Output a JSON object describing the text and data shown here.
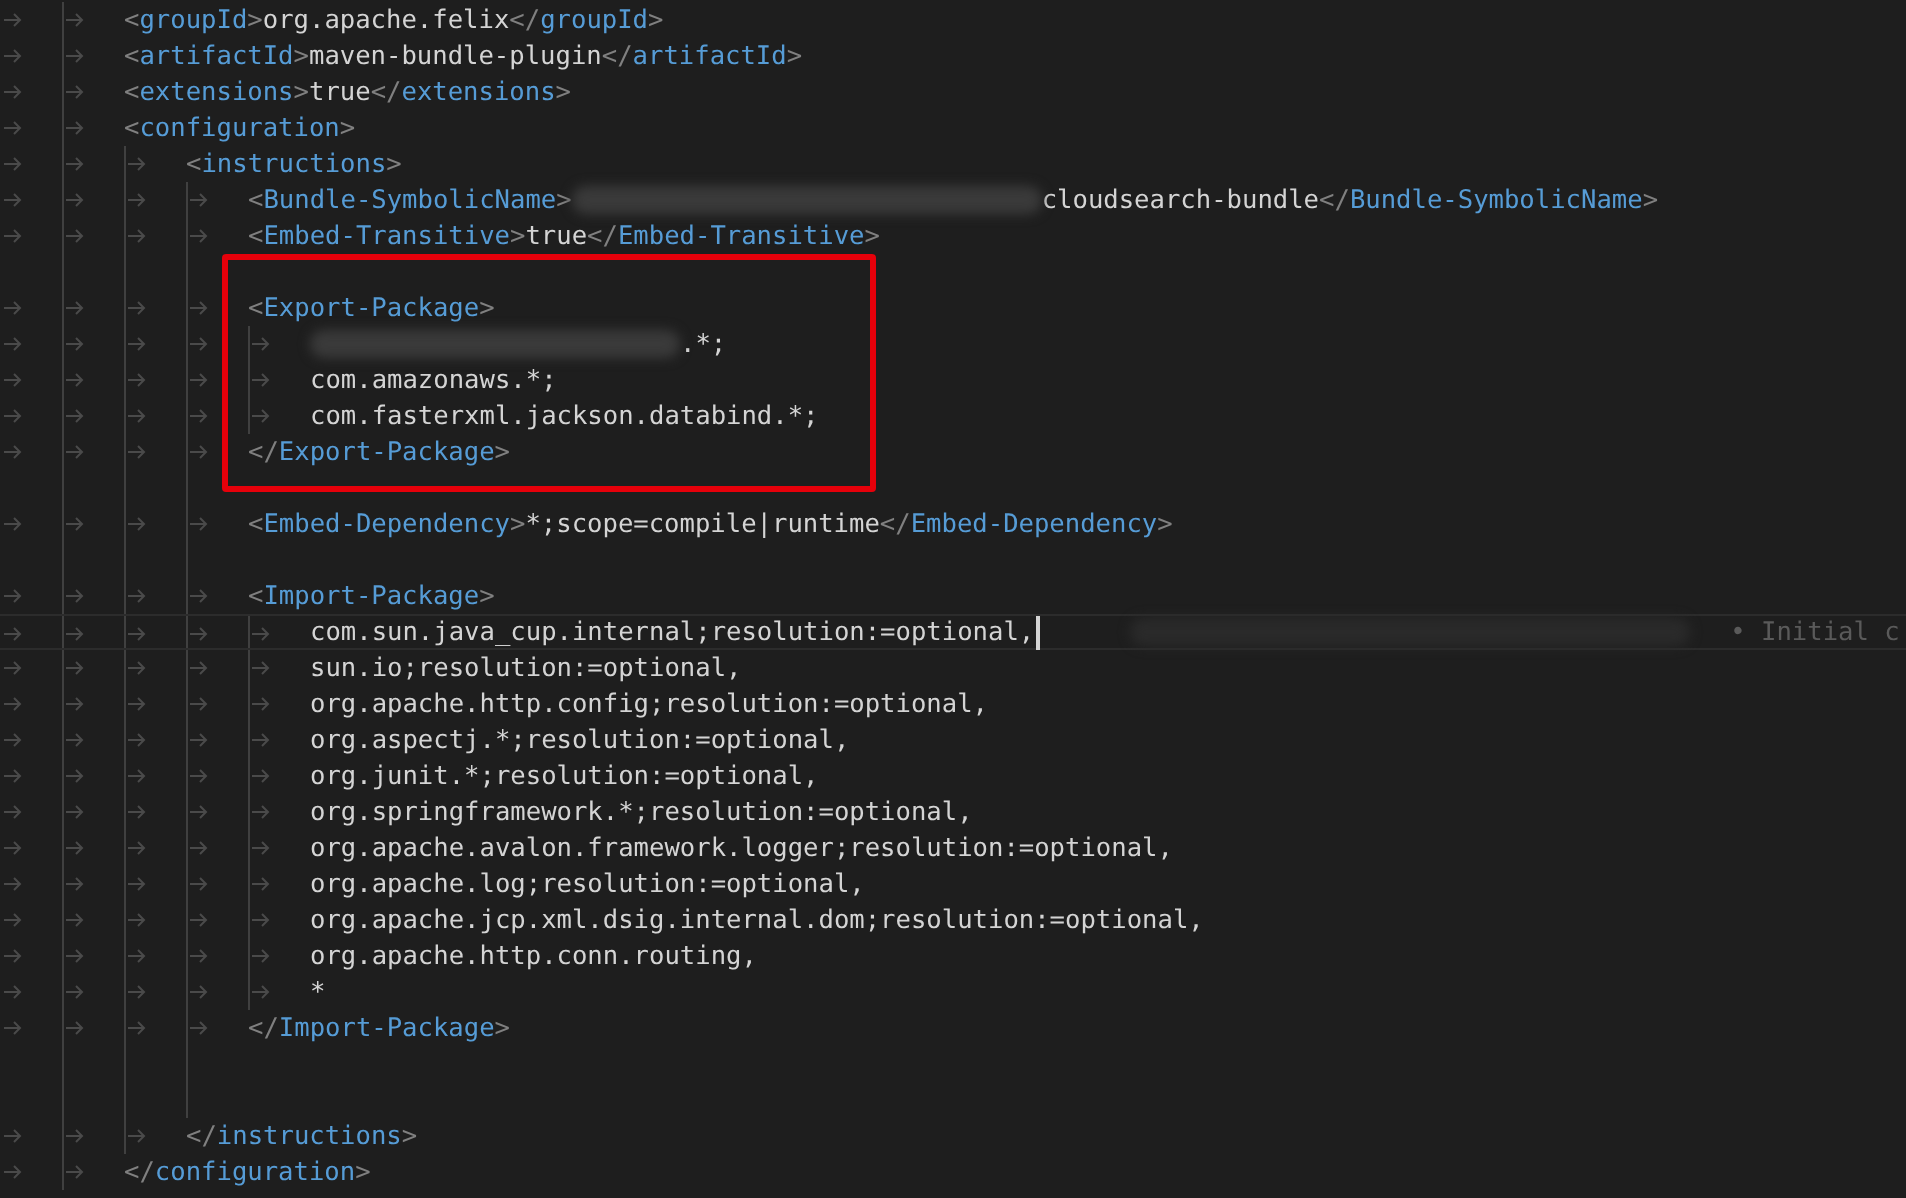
{
  "editor": {
    "lines": [
      {
        "kind": "scope",
        "children": [
          {
            "kind": "scope",
            "children": [
              {
                "kind": "line",
                "tokens": [
                  {
                    "kind": "punct",
                    "text": "<"
                  },
                  {
                    "kind": "tag",
                    "text": "groupId"
                  },
                  {
                    "kind": "punct",
                    "text": ">"
                  },
                  {
                    "kind": "text",
                    "text": "org.apache.felix"
                  },
                  {
                    "kind": "punct",
                    "text": "</"
                  },
                  {
                    "kind": "tag",
                    "text": "groupId"
                  },
                  {
                    "kind": "punct",
                    "text": ">"
                  }
                ]
              },
              {
                "kind": "line",
                "tokens": [
                  {
                    "kind": "punct",
                    "text": "<"
                  },
                  {
                    "kind": "tag",
                    "text": "artifactId"
                  },
                  {
                    "kind": "punct",
                    "text": ">"
                  },
                  {
                    "kind": "text",
                    "text": "maven-bundle-plugin"
                  },
                  {
                    "kind": "punct",
                    "text": "</"
                  },
                  {
                    "kind": "tag",
                    "text": "artifactId"
                  },
                  {
                    "kind": "punct",
                    "text": ">"
                  }
                ]
              },
              {
                "kind": "line",
                "tokens": [
                  {
                    "kind": "punct",
                    "text": "<"
                  },
                  {
                    "kind": "tag",
                    "text": "extensions"
                  },
                  {
                    "kind": "punct",
                    "text": ">"
                  },
                  {
                    "kind": "text",
                    "text": "true"
                  },
                  {
                    "kind": "punct",
                    "text": "</"
                  },
                  {
                    "kind": "tag",
                    "text": "extensions"
                  },
                  {
                    "kind": "punct",
                    "text": ">"
                  }
                ]
              },
              {
                "kind": "line",
                "tokens": [
                  {
                    "kind": "punct",
                    "text": "<"
                  },
                  {
                    "kind": "tag",
                    "text": "configuration"
                  },
                  {
                    "kind": "punct",
                    "text": ">"
                  }
                ],
                "children": [
                  {
                    "kind": "line",
                    "tokens": [
                      {
                        "kind": "punct",
                        "text": "<"
                      },
                      {
                        "kind": "tag",
                        "text": "instructions"
                      },
                      {
                        "kind": "punct",
                        "text": ">"
                      }
                    ],
                    "children": [
                      {
                        "kind": "line",
                        "tokens": [
                          {
                            "kind": "punct",
                            "text": "<"
                          },
                          {
                            "kind": "tag",
                            "text": "Bundle-SymbolicName"
                          },
                          {
                            "kind": "punct",
                            "text": ">"
                          },
                          {
                            "kind": "redacted"
                          },
                          {
                            "kind": "text",
                            "text": "cloudsearch-bundle"
                          },
                          {
                            "kind": "punct",
                            "text": "</"
                          },
                          {
                            "kind": "tag",
                            "text": "Bundle-SymbolicName"
                          },
                          {
                            "kind": "punct",
                            "text": ">"
                          }
                        ]
                      },
                      {
                        "kind": "line",
                        "tokens": [
                          {
                            "kind": "punct",
                            "text": "<"
                          },
                          {
                            "kind": "tag",
                            "text": "Embed-Transitive"
                          },
                          {
                            "kind": "punct",
                            "text": ">"
                          },
                          {
                            "kind": "text",
                            "text": "true"
                          },
                          {
                            "kind": "punct",
                            "text": "</"
                          },
                          {
                            "kind": "tag",
                            "text": "Embed-Transitive"
                          },
                          {
                            "kind": "punct",
                            "text": ">"
                          }
                        ]
                      },
                      {
                        "kind": "group",
                        "highlighted": true,
                        "children": [
                          {
                            "kind": "blank"
                          },
                          {
                            "kind": "line",
                            "tokens": [
                              {
                                "kind": "punct",
                                "text": "<"
                              },
                              {
                                "kind": "tag",
                                "text": "Export-Package"
                              },
                              {
                                "kind": "punct",
                                "text": ">"
                              }
                            ],
                            "children": [
                              {
                                "kind": "line",
                                "tokens": [
                                  {
                                    "kind": "redacted"
                                  },
                                  {
                                    "kind": "text",
                                    "text": ".*;"
                                  }
                                ]
                              },
                              {
                                "kind": "line",
                                "tokens": [
                                  {
                                    "kind": "text",
                                    "text": "com.amazonaws.*;"
                                  }
                                ]
                              },
                              {
                                "kind": "line",
                                "tokens": [
                                  {
                                    "kind": "text",
                                    "text": "com.fasterxml.jackson.databind.*;"
                                  }
                                ]
                              }
                            ]
                          },
                          {
                            "kind": "line",
                            "tokens": [
                              {
                                "kind": "punct",
                                "text": "</"
                              },
                              {
                                "kind": "tag",
                                "text": "Export-Package"
                              },
                              {
                                "kind": "punct",
                                "text": ">"
                              }
                            ]
                          }
                        ]
                      },
                      {
                        "kind": "blank"
                      },
                      {
                        "kind": "line",
                        "tokens": [
                          {
                            "kind": "punct",
                            "text": "<"
                          },
                          {
                            "kind": "tag",
                            "text": "Embed-Dependency"
                          },
                          {
                            "kind": "punct",
                            "text": ">"
                          },
                          {
                            "kind": "text",
                            "text": "*;scope=compile|runtime"
                          },
                          {
                            "kind": "punct",
                            "text": "</"
                          },
                          {
                            "kind": "tag",
                            "text": "Embed-Dependency"
                          },
                          {
                            "kind": "punct",
                            "text": ">"
                          }
                        ]
                      },
                      {
                        "kind": "blank"
                      },
                      {
                        "kind": "line",
                        "tokens": [
                          {
                            "kind": "punct",
                            "text": "<"
                          },
                          {
                            "kind": "tag",
                            "text": "Import-Package"
                          },
                          {
                            "kind": "punct",
                            "text": ">"
                          }
                        ],
                        "children": [
                          {
                            "kind": "line",
                            "cursor": true,
                            "blame": "• Initial c",
                            "tokens": [
                              {
                                "kind": "text",
                                "text": "com.sun.java_cup.internal;resolution:=optional,"
                              }
                            ]
                          },
                          {
                            "kind": "line",
                            "tokens": [
                              {
                                "kind": "text",
                                "text": "sun.io;resolution:=optional,"
                              }
                            ]
                          },
                          {
                            "kind": "line",
                            "tokens": [
                              {
                                "kind": "text",
                                "text": "org.apache.http.config;resolution:=optional,"
                              }
                            ]
                          },
                          {
                            "kind": "line",
                            "tokens": [
                              {
                                "kind": "text",
                                "text": "org.aspectj.*;resolution:=optional,"
                              }
                            ]
                          },
                          {
                            "kind": "line",
                            "tokens": [
                              {
                                "kind": "text",
                                "text": "org.junit.*;resolution:=optional,"
                              }
                            ]
                          },
                          {
                            "kind": "line",
                            "tokens": [
                              {
                                "kind": "text",
                                "text": "org.springframework.*;resolution:=optional,"
                              }
                            ]
                          },
                          {
                            "kind": "line",
                            "tokens": [
                              {
                                "kind": "text",
                                "text": "org.apache.avalon.framework.logger;resolution:=optional,"
                              }
                            ]
                          },
                          {
                            "kind": "line",
                            "tokens": [
                              {
                                "kind": "text",
                                "text": "org.apache.log;resolution:=optional,"
                              }
                            ]
                          },
                          {
                            "kind": "line",
                            "tokens": [
                              {
                                "kind": "text",
                                "text": "org.apache.jcp.xml.dsig.internal.dom;resolution:=optional,"
                              }
                            ]
                          },
                          {
                            "kind": "line",
                            "tokens": [
                              {
                                "kind": "text",
                                "text": "org.apache.http.conn.routing,"
                              }
                            ]
                          },
                          {
                            "kind": "line",
                            "tokens": [
                              {
                                "kind": "text",
                                "text": "*"
                              }
                            ]
                          }
                        ]
                      },
                      {
                        "kind": "line",
                        "tokens": [
                          {
                            "kind": "punct",
                            "text": "</"
                          },
                          {
                            "kind": "tag",
                            "text": "Import-Package"
                          },
                          {
                            "kind": "punct",
                            "text": ">"
                          }
                        ]
                      },
                      {
                        "kind": "blank"
                      },
                      {
                        "kind": "blank"
                      }
                    ]
                  },
                  {
                    "kind": "line",
                    "tokens": [
                      {
                        "kind": "punct",
                        "text": "</"
                      },
                      {
                        "kind": "tag",
                        "text": "instructions"
                      },
                      {
                        "kind": "punct",
                        "text": ">"
                      }
                    ]
                  }
                ]
              },
              {
                "kind": "line",
                "tokens": [
                  {
                    "kind": "punct",
                    "text": "</"
                  },
                  {
                    "kind": "tag",
                    "text": "configuration"
                  },
                  {
                    "kind": "punct",
                    "text": ">"
                  }
                ]
              }
            ]
          }
        ]
      }
    ]
  }
}
